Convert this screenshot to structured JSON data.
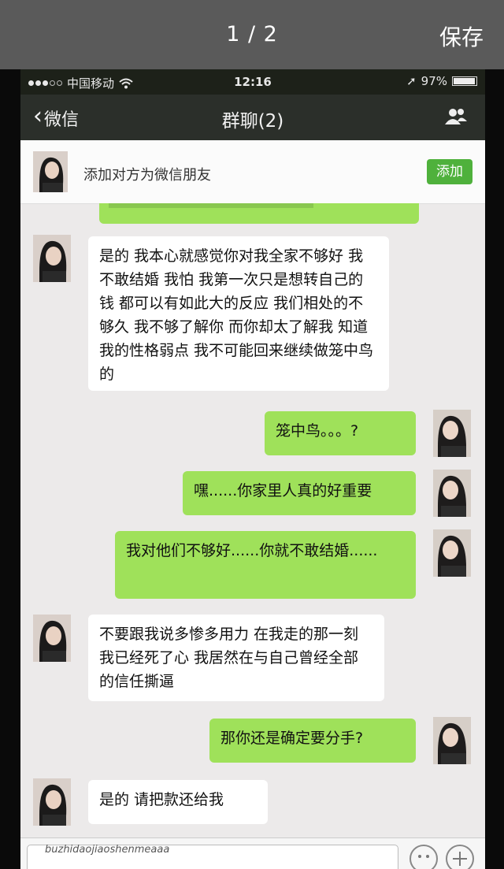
{
  "viewer": {
    "counter": "1 / 2",
    "save": "保存"
  },
  "status_bar": {
    "carrier": "中国移动",
    "time": "12:16",
    "battery": "97%",
    "battery_fraction": 0.97
  },
  "nav": {
    "back": "微信",
    "title": "群聊(2)",
    "members_icon": "people-icon"
  },
  "add_friend": {
    "text": "添加对方为微信朋友",
    "button": "添加"
  },
  "messages": [
    {
      "side": "in",
      "text": "是的 我本心就感觉你对我全家不够好 我不敢结婚 我怕 我第一次只是想转自己的钱 都可以有如此大的反应 我们相处的不够久 我不够了解你 而你却太了解我 知道我的性格弱点 我不可能回来继续做笼中鸟的"
    },
    {
      "side": "out",
      "text": "笼中鸟。。。?"
    },
    {
      "side": "out",
      "text": "嘿......你家里人真的好重要"
    },
    {
      "side": "out",
      "text": "我对他们不够好......你就不敢结婚......"
    },
    {
      "side": "in",
      "text": "不要跟我说多惨多用力  在我走的那一刻 我已经死了心  我居然在与自己曾经全部的信任撕逼"
    },
    {
      "side": "out",
      "text": "那你还是确定要分手?"
    },
    {
      "side": "in",
      "text": "是的  请把款还给我"
    }
  ],
  "input": {
    "watermark": "buzhidaojiaoshenmeaaa",
    "emoji_icon": "emoji-icon",
    "plus_icon": "plus-icon"
  },
  "colors": {
    "bubble_out": "#9fe15a",
    "bubble_in": "#ffffff",
    "add_button": "#4fb13c",
    "nav_bg": "#2b2f2a"
  }
}
